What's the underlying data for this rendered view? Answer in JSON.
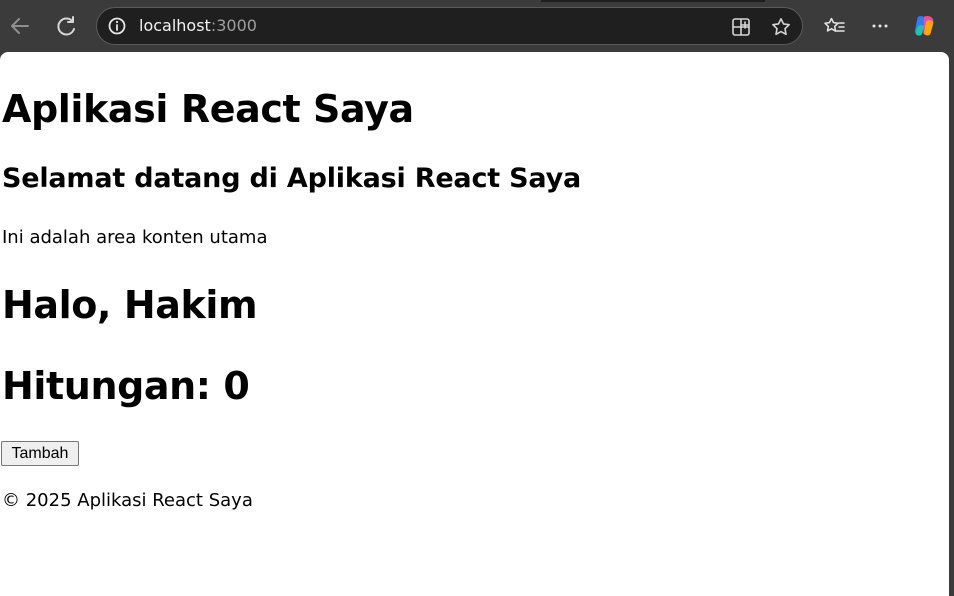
{
  "browser": {
    "url_host": "localhost",
    "url_port": ":3000",
    "toolbar_icons": [
      "back-icon",
      "refresh-icon",
      "site-info-icon",
      "app-available-icon",
      "favorite-star-icon",
      "favorites-icon",
      "more-icon",
      "copilot-icon"
    ]
  },
  "page": {
    "title": "Aplikasi React Saya",
    "welcome": "Selamat datang di Aplikasi React Saya",
    "main_text": "Ini adalah area konten utama",
    "greeting": "Halo, Hakim",
    "counter_text": "Hitungan: 0",
    "button_label": "Tambah",
    "footer": "© 2025 Aplikasi React Saya"
  },
  "colors": {
    "browser_toolbar": "#3b3b3b",
    "address_bar": "#1f1f1f",
    "page_background": "#ffffff",
    "text": "#000000",
    "button_background": "#efefef",
    "button_border": "#767676"
  }
}
